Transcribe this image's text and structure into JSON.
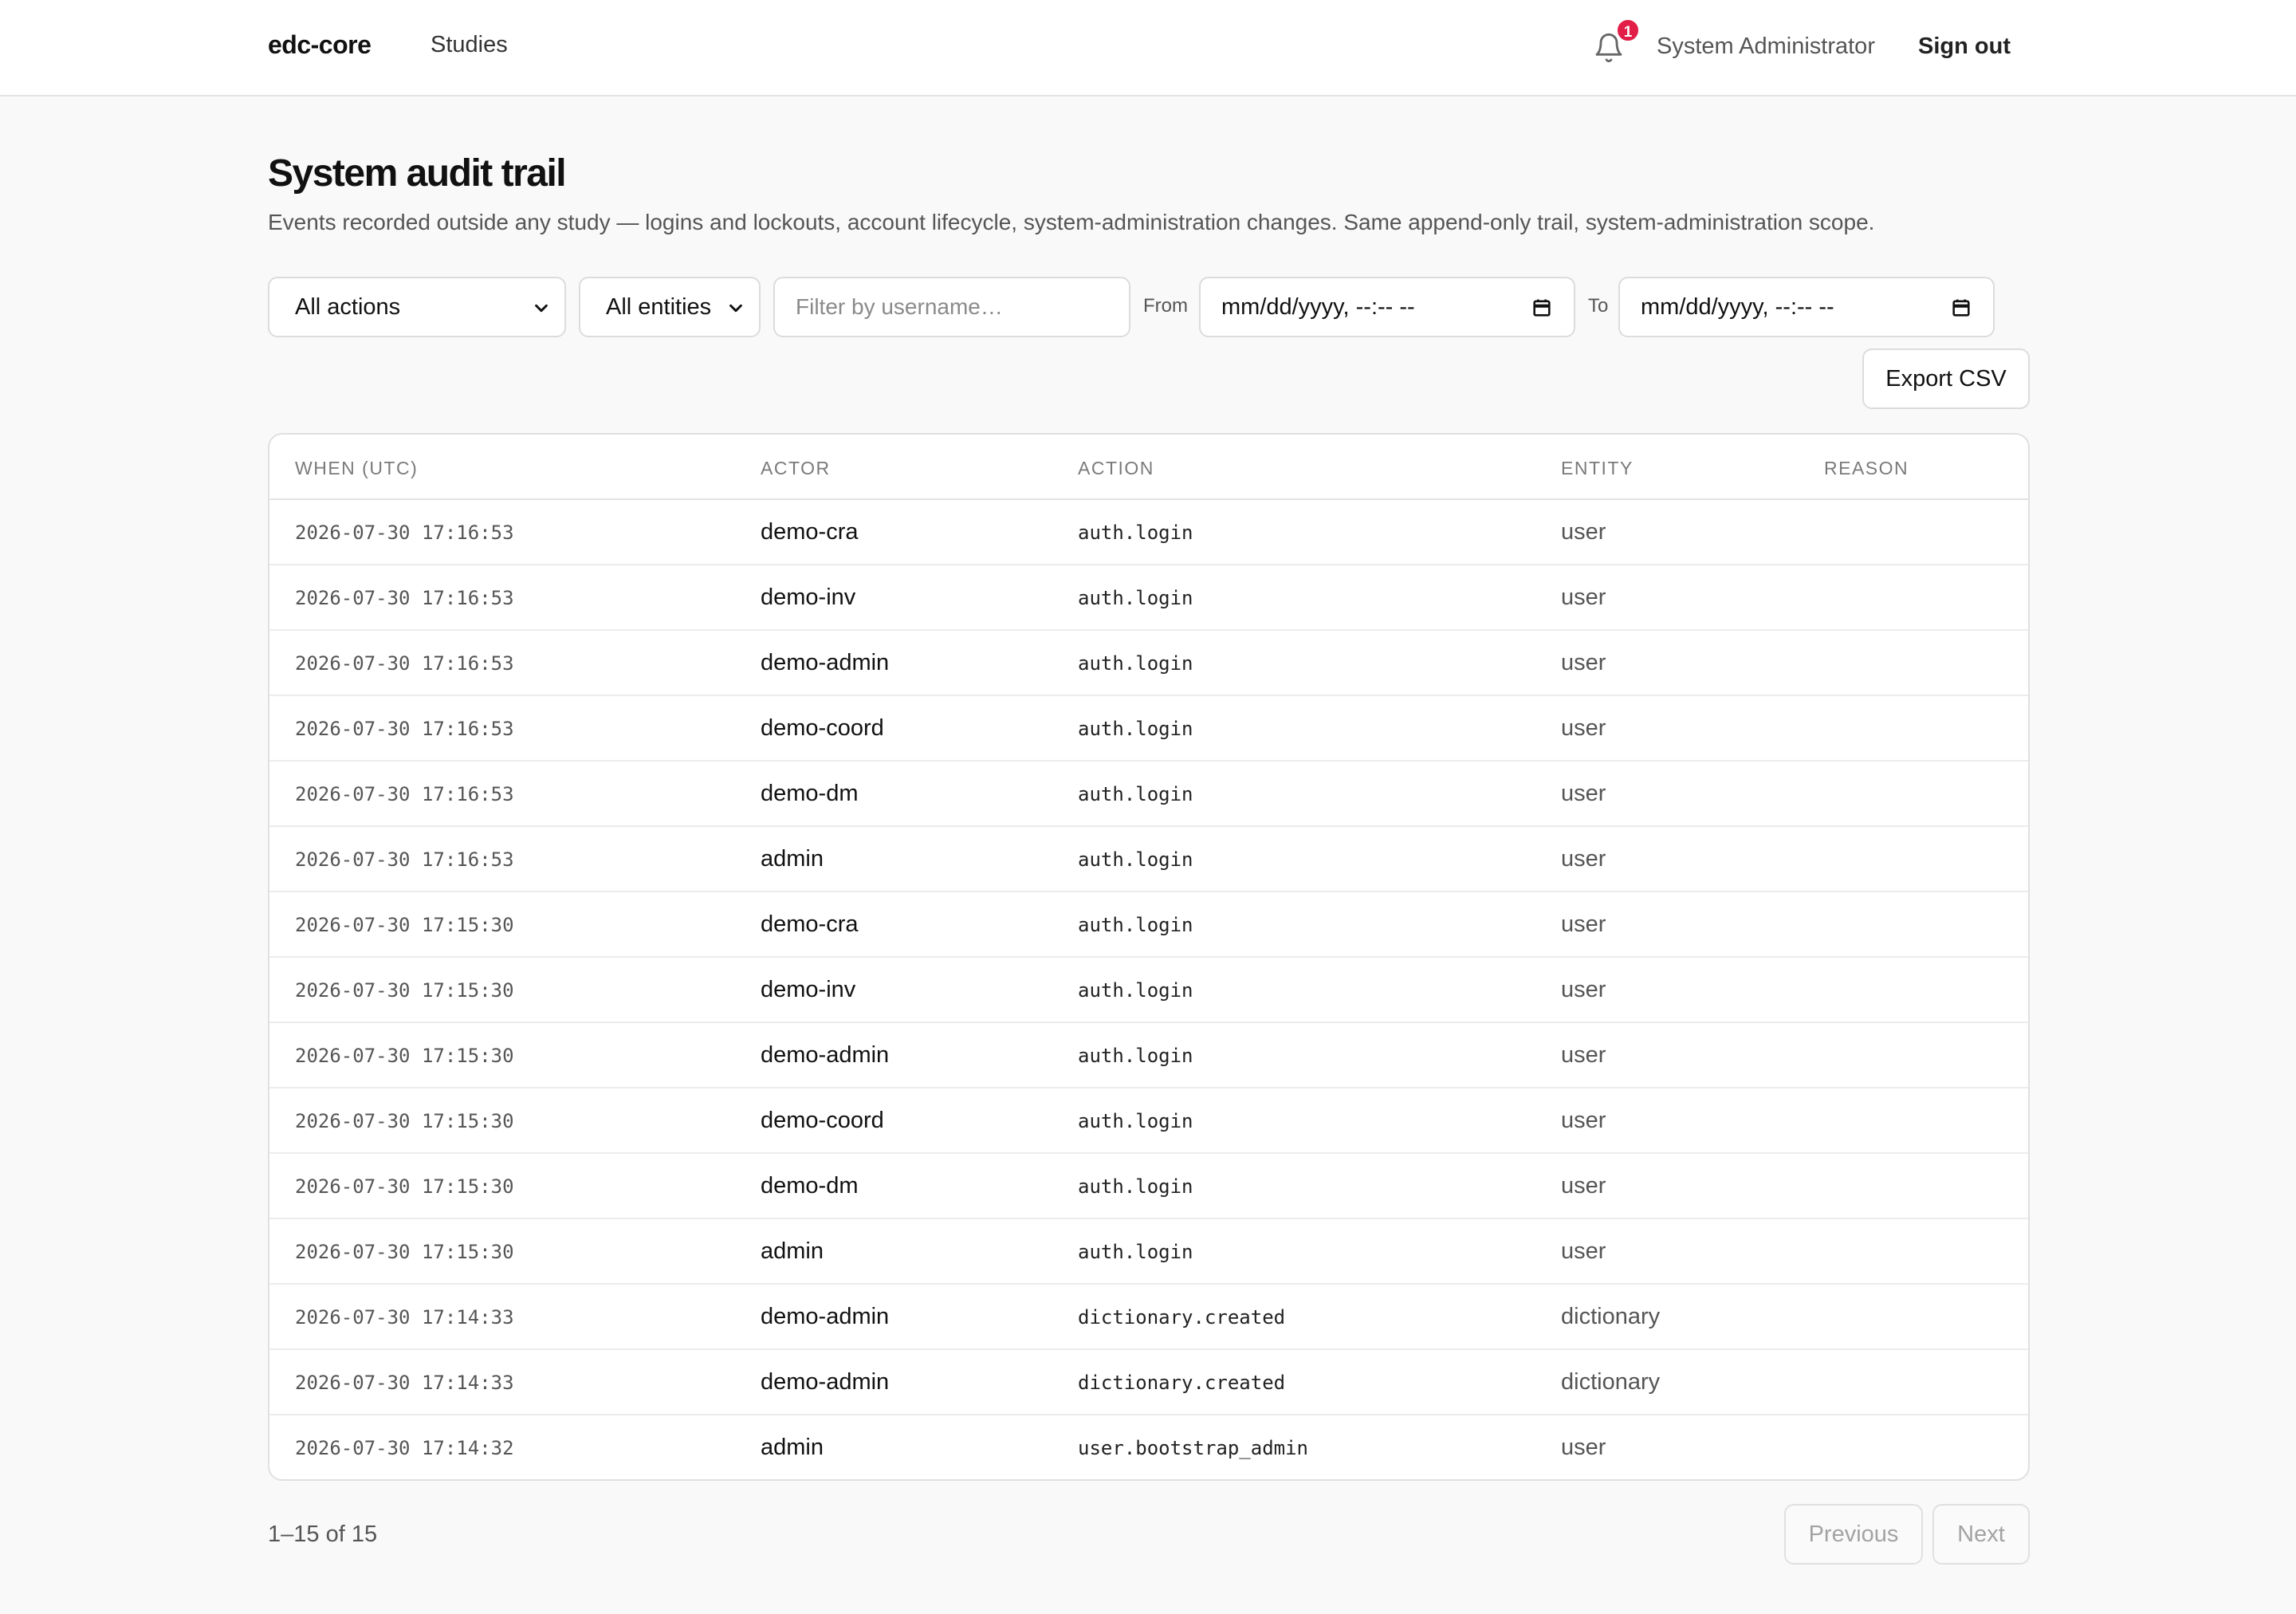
{
  "header": {
    "brand": "edc-core",
    "nav_studies": "Studies",
    "notifications_count": "1",
    "user_name": "System Administrator",
    "sign_out": "Sign out"
  },
  "page": {
    "title": "System audit trail",
    "description": "Events recorded outside any study — logins and lockouts, account lifecycle, system-administration changes. Same append-only trail, system-administration scope."
  },
  "filters": {
    "actions_selected": "All actions",
    "entities_selected": "All entities",
    "username_placeholder": "Filter by username…",
    "from_label": "From",
    "from_value": "mm/dd/yyyy, --:-- --",
    "to_label": "To",
    "to_value": "mm/dd/yyyy, --:-- --",
    "export_label": "Export CSV"
  },
  "table": {
    "columns": [
      "When (UTC)",
      "Actor",
      "Action",
      "Entity",
      "Reason"
    ],
    "rows": [
      {
        "when": "2026-07-30 17:16:53",
        "actor": "demo-cra",
        "action": "auth.login",
        "entity": "user",
        "reason": ""
      },
      {
        "when": "2026-07-30 17:16:53",
        "actor": "demo-inv",
        "action": "auth.login",
        "entity": "user",
        "reason": ""
      },
      {
        "when": "2026-07-30 17:16:53",
        "actor": "demo-admin",
        "action": "auth.login",
        "entity": "user",
        "reason": ""
      },
      {
        "when": "2026-07-30 17:16:53",
        "actor": "demo-coord",
        "action": "auth.login",
        "entity": "user",
        "reason": ""
      },
      {
        "when": "2026-07-30 17:16:53",
        "actor": "demo-dm",
        "action": "auth.login",
        "entity": "user",
        "reason": ""
      },
      {
        "when": "2026-07-30 17:16:53",
        "actor": "admin",
        "action": "auth.login",
        "entity": "user",
        "reason": ""
      },
      {
        "when": "2026-07-30 17:15:30",
        "actor": "demo-cra",
        "action": "auth.login",
        "entity": "user",
        "reason": ""
      },
      {
        "when": "2026-07-30 17:15:30",
        "actor": "demo-inv",
        "action": "auth.login",
        "entity": "user",
        "reason": ""
      },
      {
        "when": "2026-07-30 17:15:30",
        "actor": "demo-admin",
        "action": "auth.login",
        "entity": "user",
        "reason": ""
      },
      {
        "when": "2026-07-30 17:15:30",
        "actor": "demo-coord",
        "action": "auth.login",
        "entity": "user",
        "reason": ""
      },
      {
        "when": "2026-07-30 17:15:30",
        "actor": "demo-dm",
        "action": "auth.login",
        "entity": "user",
        "reason": ""
      },
      {
        "when": "2026-07-30 17:15:30",
        "actor": "admin",
        "action": "auth.login",
        "entity": "user",
        "reason": ""
      },
      {
        "when": "2026-07-30 17:14:33",
        "actor": "demo-admin",
        "action": "dictionary.created",
        "entity": "dictionary",
        "reason": ""
      },
      {
        "when": "2026-07-30 17:14:33",
        "actor": "demo-admin",
        "action": "dictionary.created",
        "entity": "dictionary",
        "reason": ""
      },
      {
        "when": "2026-07-30 17:14:32",
        "actor": "admin",
        "action": "user.bootstrap_admin",
        "entity": "user",
        "reason": ""
      }
    ]
  },
  "pager": {
    "count": "1–15 of 15",
    "previous": "Previous",
    "next": "Next"
  },
  "colors": {
    "badge": "#e11d48",
    "background": "#f9f9f9"
  }
}
